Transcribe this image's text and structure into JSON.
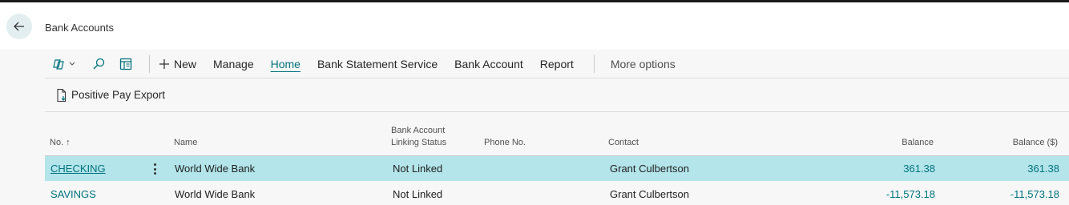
{
  "page": {
    "title": "Bank Accounts"
  },
  "actionbar": {
    "new_label": "New",
    "manage_label": "Manage",
    "home_label": "Home",
    "bank_statement_label": "Bank Statement Service",
    "bank_account_label": "Bank Account",
    "report_label": "Report",
    "more_options_label": "More options"
  },
  "subbar": {
    "positive_pay_export_label": "Positive Pay Export"
  },
  "table": {
    "headers": {
      "no": "No. ↑",
      "name": "Name",
      "linking_line1": "Bank Account",
      "linking_line2": "Linking Status",
      "phone": "Phone No.",
      "contact": "Contact",
      "balance": "Balance",
      "balance_usd": "Balance ($)"
    },
    "rows": [
      {
        "no": "CHECKING",
        "name": "World Wide Bank",
        "linking_status": "Not Linked",
        "phone": "",
        "contact": "Grant Culbertson",
        "balance": "361.38",
        "balance_usd": "361.38",
        "selected": true
      },
      {
        "no": "SAVINGS",
        "name": "World Wide Bank",
        "linking_status": "Not Linked",
        "phone": "",
        "contact": "Grant Culbertson",
        "balance": "-11,573.18",
        "balance_usd": "-11,573.18",
        "selected": false
      }
    ]
  },
  "icons": {
    "back": "arrow-left-icon",
    "views": "views-icon",
    "search": "search-icon",
    "filter_pane": "filter-pane-icon",
    "new": "plus-icon",
    "export": "document-export-icon",
    "row_menu": "more-vertical-icon"
  },
  "colors": {
    "accent": "#00727e",
    "selected_row": "#b3e5ea",
    "back_button": "#e3eef0"
  }
}
